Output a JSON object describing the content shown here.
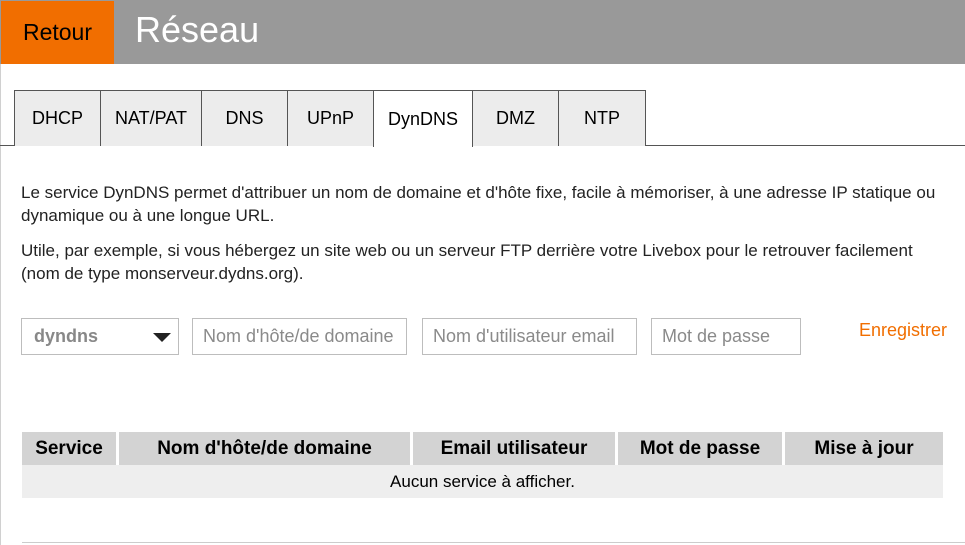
{
  "header": {
    "back_label": "Retour",
    "title": "Réseau",
    "accent_color": "#f16e00",
    "bar_color": "#999999"
  },
  "tabs": [
    {
      "label": "DHCP",
      "active": false
    },
    {
      "label": "NAT/PAT",
      "active": false
    },
    {
      "label": "DNS",
      "active": false
    },
    {
      "label": "UPnP",
      "active": false
    },
    {
      "label": "DynDNS",
      "active": true
    },
    {
      "label": "DMZ",
      "active": false
    },
    {
      "label": "NTP",
      "active": false
    }
  ],
  "description": {
    "paragraph1": "Le service DynDNS permet d'attribuer un nom de domaine et d'hôte fixe, facile à mémoriser, à une adresse IP statique ou dynamique ou à une longue URL.",
    "paragraph2": "Utile, par exemple, si vous hébergez un site web ou un serveur FTP derrière votre Livebox pour le retrouver facilement (nom de type monserveur.dydns.org)."
  },
  "form": {
    "provider_selected": "dyndns",
    "hostname_placeholder": "Nom d'hôte/de domaine",
    "hostname_value": "",
    "email_placeholder": "Nom d'utilisateur email",
    "email_value": "",
    "password_placeholder": "Mot de passe",
    "password_value": "",
    "save_label": "Enregistrer"
  },
  "table": {
    "columns": [
      "Service",
      "Nom d'hôte/de domaine",
      "Email utilisateur",
      "Mot de passe",
      "Mise à jour"
    ],
    "empty_message": "Aucun service à afficher."
  }
}
